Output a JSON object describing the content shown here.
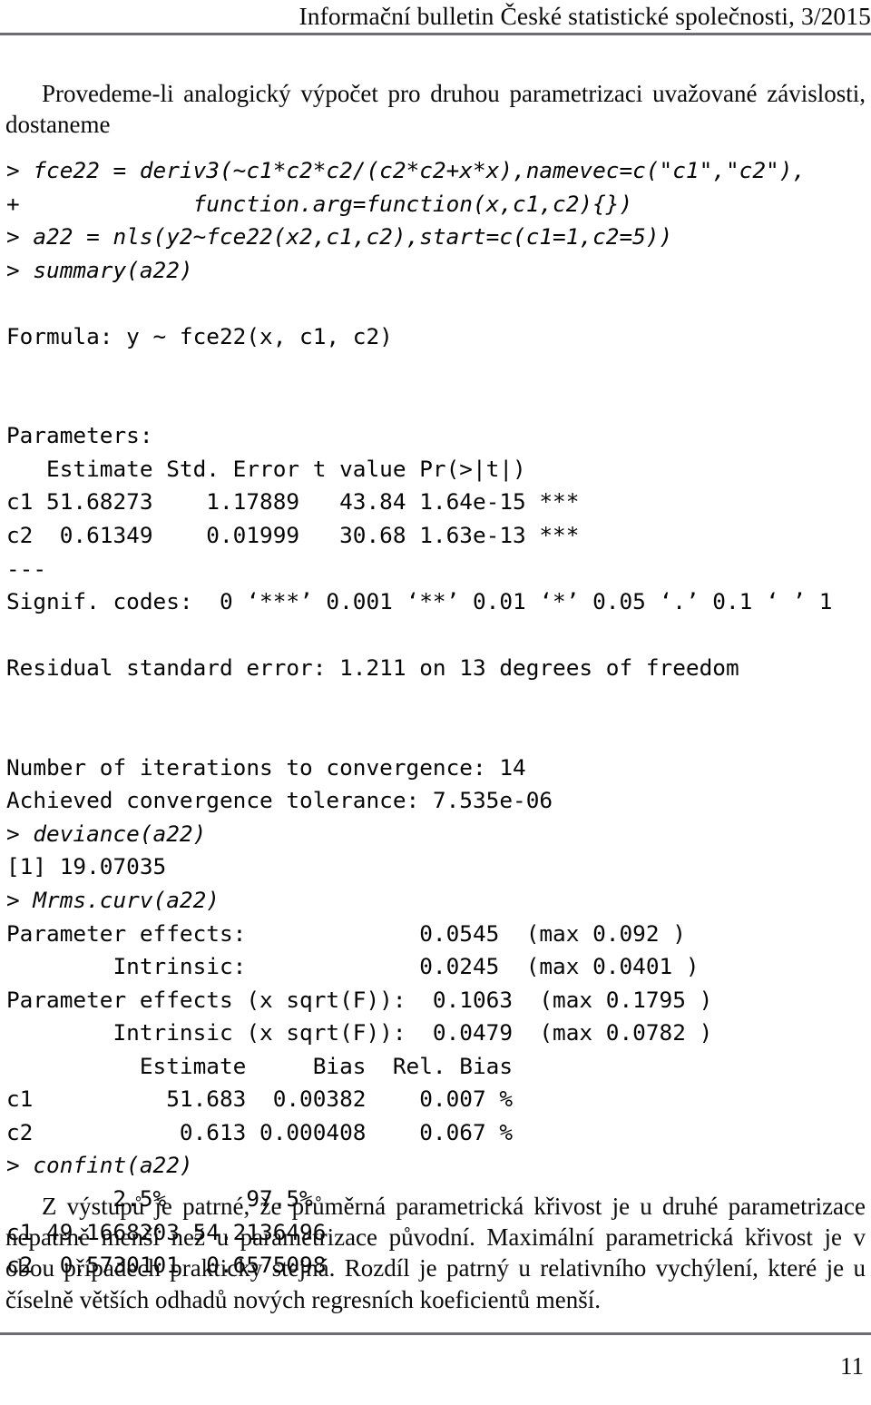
{
  "header": {
    "running_title": "Informační bulletin České statistické společnosti, 3/2015",
    "rule_color": "#6d6d72"
  },
  "paragraphs": {
    "intro": "Provedeme-li analogický výpočet pro druhou parametrizaci uvažované závislosti, dostaneme",
    "conclusion": "Z výstupů je patrné, že průměrná parametrická křivost je u druhé parametrizace nepatrně menší než u parametrizace původní. Maximální parametrická křivost je v obou případech prakticky stejná. Rozdíl je patrný u relativního vychýlení, které je u číselně větších odhadů nových regresních koeficientů menší."
  },
  "code_block": {
    "lines": [
      {
        "kind": "cmd",
        "text": "> fce22 = deriv3(~c1*c2*c2/(c2*c2+x*x),namevec=c(\"c1\",\"c2\"),"
      },
      {
        "kind": "cmd",
        "text": "+             function.arg=function(x,c1,c2){})"
      },
      {
        "kind": "cmd",
        "text": "> a22 = nls(y2~fce22(x2,c1,c2),start=c(c1=1,c2=5))"
      },
      {
        "kind": "cmd",
        "text": "> summary(a22)"
      },
      {
        "kind": "blank",
        "text": ""
      },
      {
        "kind": "out",
        "text": "Formula: y ~ fce22(x, c1, c2)"
      },
      {
        "kind": "blank",
        "text": ""
      },
      {
        "kind": "blank",
        "text": ""
      },
      {
        "kind": "out",
        "text": "Parameters:"
      },
      {
        "kind": "out",
        "text": "   Estimate Std. Error t value Pr(>|t|)"
      },
      {
        "kind": "out",
        "text": "c1 51.68273    1.17889   43.84 1.64e-15 ***"
      },
      {
        "kind": "out",
        "text": "c2  0.61349    0.01999   30.68 1.63e-13 ***"
      },
      {
        "kind": "out",
        "text": "---"
      },
      {
        "kind": "out",
        "text": "Signif. codes:  0 ‘***’ 0.001 ‘**’ 0.01 ‘*’ 0.05 ‘.’ 0.1 ‘ ’ 1"
      },
      {
        "kind": "blank",
        "text": ""
      },
      {
        "kind": "out",
        "text": "Residual standard error: 1.211 on 13 degrees of freedom"
      },
      {
        "kind": "blank",
        "text": ""
      },
      {
        "kind": "blank",
        "text": ""
      },
      {
        "kind": "out",
        "text": "Number of iterations to convergence: 14"
      },
      {
        "kind": "out",
        "text": "Achieved convergence tolerance: 7.535e-06"
      },
      {
        "kind": "cmd",
        "text": "> deviance(a22)"
      },
      {
        "kind": "out",
        "text": "[1] 19.07035"
      },
      {
        "kind": "cmd",
        "text": "> Mrms.curv(a22)"
      },
      {
        "kind": "out",
        "text": "Parameter effects:             0.0545  (max 0.092 )"
      },
      {
        "kind": "out",
        "text": "        Intrinsic:             0.0245  (max 0.0401 )"
      },
      {
        "kind": "out",
        "text": "Parameter effects (x sqrt(F)):  0.1063  (max 0.1795 )"
      },
      {
        "kind": "out",
        "text": "        Intrinsic (x sqrt(F)):  0.0479  (max 0.0782 )"
      },
      {
        "kind": "out",
        "text": "          Estimate     Bias  Rel. Bias"
      },
      {
        "kind": "out",
        "text": "c1          51.683  0.00382    0.007 %"
      },
      {
        "kind": "out",
        "text": "c2           0.613 0.000408    0.067 %"
      },
      {
        "kind": "cmd",
        "text": "> confint(a22)"
      },
      {
        "kind": "out",
        "text": "        2.5%      97.5%"
      },
      {
        "kind": "out",
        "text": "c1 49.1668203 54.2136496"
      },
      {
        "kind": "out",
        "text": "c2  0.5730101  0.6575098"
      }
    ]
  },
  "footer": {
    "page_number": "11"
  }
}
